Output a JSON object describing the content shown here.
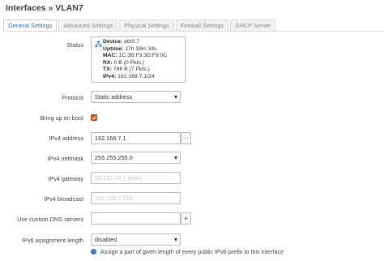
{
  "header": {
    "title": "Interfaces » VLAN7"
  },
  "tabs": [
    {
      "label": "General Settings",
      "active": true
    },
    {
      "label": "Advanced Settings"
    },
    {
      "label": "Physical Settings"
    },
    {
      "label": "Firewall Settings"
    },
    {
      "label": "DHCP Server"
    }
  ],
  "status": {
    "label": "Status",
    "icon": "network-ports-icon",
    "device_key": "Device:",
    "device_val": "eth0.7",
    "uptime_key": "Uptime:",
    "uptime_val": "17h 39m 34s",
    "mac_key": "MAC:",
    "mac_val": "1C:3B:F3:3D:F9:0C",
    "rx_key": "RX:",
    "rx_val": "0 B (0 Pkts.)",
    "tx_key": "TX:",
    "tx_val": "786 B (7 Pkts.)",
    "ipv4_key": "IPv4:",
    "ipv4_val": "192.168.7.1/24"
  },
  "form": {
    "protocol": {
      "label": "Protocol",
      "value": "Static address"
    },
    "boot": {
      "label": "Bring up on boot",
      "checked": true
    },
    "ipv4_address": {
      "label": "IPv4 address",
      "value": "192.168.7.1",
      "button": "..."
    },
    "ipv4_netmask": {
      "label": "IPv4 netmask",
      "value": "255.255.255.0"
    },
    "ipv4_gateway": {
      "label": "IPv4 gateway",
      "placeholder": "69.132.48.1 (wan)"
    },
    "ipv4_broadcast": {
      "label": "IPv4 broadcast",
      "placeholder": "192.168.7.255"
    },
    "dns": {
      "label": "Use custom DNS servers",
      "value": "",
      "button": "+"
    },
    "ipv6_len": {
      "label": "IPv6 assignment length",
      "value": "disabled"
    },
    "help_text": "Assign a part of given length of every public IPv6-prefix to this interface"
  },
  "colors": {
    "accent": "#2a72c6",
    "checkbox": "#c9581d",
    "add_button": "#2e9e2e"
  }
}
